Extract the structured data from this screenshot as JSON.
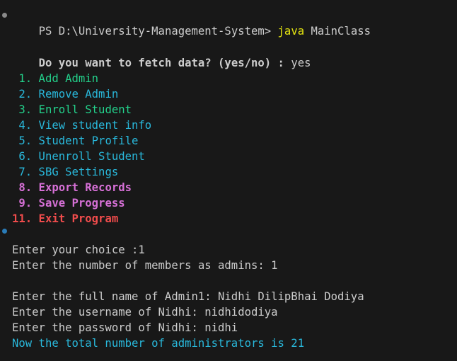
{
  "colors": {
    "background": "#181818",
    "default_text": "#cccccc",
    "command_yellow": "#e5e510",
    "green": "#23d18b",
    "cyan": "#29b8db",
    "blue_marker": "#2a7cb8",
    "marker_gray": "#8a8a8a",
    "magenta": "#d670d6",
    "red": "#f14c4c"
  },
  "prompt": {
    "text": "PS D:\\University-Management-System> ",
    "command": "java",
    "args": " MainClass"
  },
  "fetch_question": {
    "question": "Do you want to fetch data? (yes/no) : ",
    "answer": "yes"
  },
  "menu": [
    {
      "num": " 1.",
      "label": " Add Admin",
      "color": "#23d18b",
      "bold": false
    },
    {
      "num": " 2.",
      "label": " Remove Admin",
      "color": "#29b8db",
      "bold": false
    },
    {
      "num": " 3.",
      "label": " Enroll Student",
      "color": "#23d18b",
      "bold": false
    },
    {
      "num": " 4.",
      "label": " View student info",
      "color": "#29b8db",
      "bold": false
    },
    {
      "num": " 5.",
      "label": " Student Profile",
      "color": "#29b8db",
      "bold": false
    },
    {
      "num": " 6.",
      "label": " Unenroll Student",
      "color": "#29b8db",
      "bold": false
    },
    {
      "num": " 7.",
      "label": " SBG Settings",
      "color": "#29b8db",
      "bold": false
    },
    {
      "num": " 8.",
      "label": " Export Records",
      "color": "#d670d6",
      "bold": true
    },
    {
      "num": " 9.",
      "label": " Save Progress",
      "color": "#d670d6",
      "bold": true
    },
    {
      "num": "11.",
      "label": " Exit Program",
      "color": "#f14c4c",
      "bold": true
    }
  ],
  "session": {
    "choice": "Enter your choice :1",
    "admin_count": "Enter the number of members as admins: 1",
    "full_name": "Enter the full name of Admin1: Nidhi DilipBhai Dodiya",
    "username": "Enter the username of Nidhi: nidhidodiya",
    "password": "Enter the password of Nidhi: nidhi",
    "total": "Now the total number of administrators is 21"
  }
}
